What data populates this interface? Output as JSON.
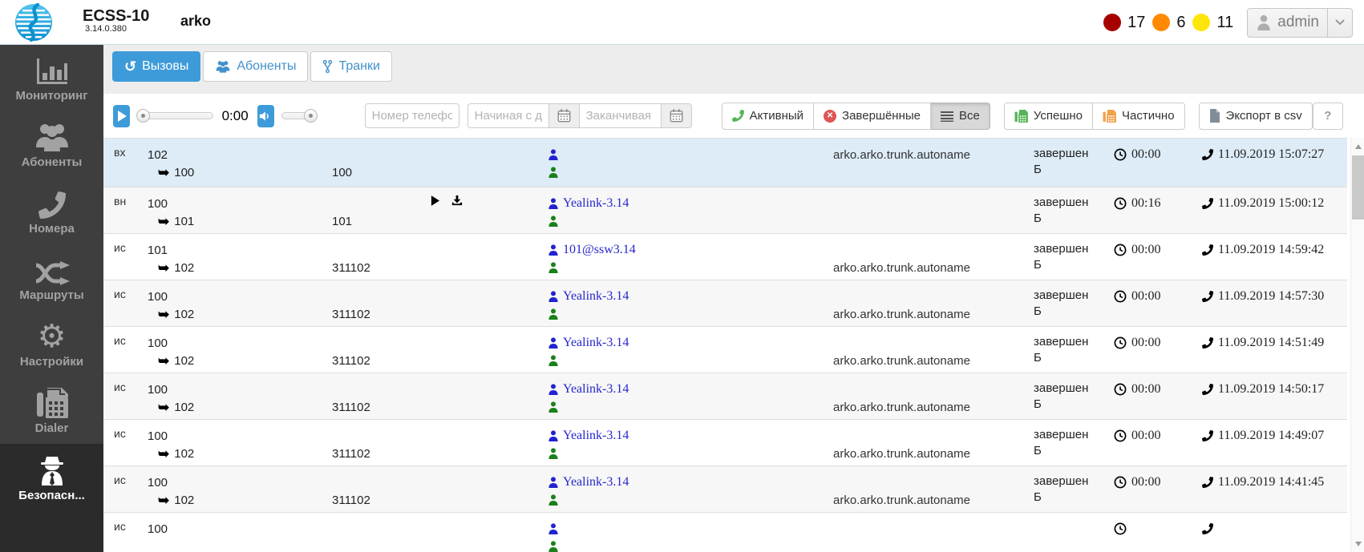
{
  "header": {
    "product": "ECSS-10",
    "version": "3.14.0.380",
    "domain": "arko",
    "alarms": [
      {
        "name": "critical",
        "color": "#a60000",
        "count": "17"
      },
      {
        "name": "major",
        "color": "#ff8a00",
        "count": "6"
      },
      {
        "name": "minor",
        "color": "#ffe60a",
        "count": "11"
      }
    ],
    "user": {
      "name": "admin"
    }
  },
  "sidebar": {
    "items": [
      {
        "label": "Мониторинг",
        "icon": "bar-chart-icon",
        "active": false
      },
      {
        "label": "Абоненты",
        "icon": "users-icon",
        "active": false
      },
      {
        "label": "Номера",
        "icon": "phone-icon",
        "active": false
      },
      {
        "label": "Маршруты",
        "icon": "shuffle-icon",
        "active": false
      },
      {
        "label": "Настройки",
        "icon": "gear-icon",
        "active": false
      },
      {
        "label": "Dialer",
        "icon": "fax-icon",
        "active": false
      },
      {
        "label": "Безопасн...",
        "icon": "spy-icon",
        "active": true
      }
    ]
  },
  "tabs": [
    {
      "label": "Вызовы",
      "icon": "history-icon",
      "active": true
    },
    {
      "label": "Абоненты",
      "icon": "users-icon",
      "active": false
    },
    {
      "label": "Транки",
      "icon": "branch-icon",
      "active": false
    }
  ],
  "player": {
    "time": "0:00",
    "progress_percent": 0,
    "volume_percent": 100
  },
  "filters": {
    "phone_placeholder": "Номер телефона",
    "date_from_placeholder": "Начиная с даты",
    "date_to_placeholder": "Заканчивая датой",
    "btn_active": "Активный",
    "btn_finished": "Завершённые",
    "btn_all": "Все",
    "btn_success": "Успешно",
    "btn_partial": "Частично",
    "btn_export": "Экспорт в csv",
    "btn_help": "?"
  },
  "icons": {
    "history-glyph": "↺",
    "arrow-forward-glyph": "➥",
    "x-glyph": "✕",
    "gear-glyph": "⚙"
  },
  "colors": {
    "accent_blue": "#3e9bd9",
    "tab_link_blue": "#4191ca",
    "selected_row": "#ddecf7",
    "caller_person": "#2222d2",
    "callee_person": "#1b801b",
    "success_green": "#56b456",
    "partial_orange": "#f0a24c",
    "finished_red": "#dd5655"
  },
  "table": {
    "rows": [
      {
        "type": "вх",
        "caller": "102",
        "callee": "100",
        "redirect": "100",
        "caller_label": "",
        "callee_label": "",
        "has_playback": false,
        "trunk": "arko.arko.trunk.autoname",
        "trunk_line": 1,
        "status_line1": "завершен",
        "status_line2": "Б",
        "duration": "00:00",
        "datetime": "11.09.2019 15:07:27",
        "selected": true
      },
      {
        "type": "вн",
        "caller": "100",
        "callee": "101",
        "redirect": "101",
        "caller_label": "Yealink-3.14",
        "callee_label": "",
        "has_playback": true,
        "trunk": "",
        "trunk_line": 2,
        "status_line1": "завершен",
        "status_line2": "Б",
        "duration": "00:16",
        "datetime": "11.09.2019 15:00:12",
        "selected": false
      },
      {
        "type": "ис",
        "caller": "101",
        "callee": "102",
        "redirect": "311102",
        "caller_label": "101@ssw3.14",
        "callee_label": "",
        "has_playback": false,
        "trunk": "arko.arko.trunk.autoname",
        "trunk_line": 2,
        "status_line1": "завершен",
        "status_line2": "Б",
        "duration": "00:00",
        "datetime": "11.09.2019 14:59:42",
        "selected": false
      },
      {
        "type": "ис",
        "caller": "100",
        "callee": "102",
        "redirect": "311102",
        "caller_label": "Yealink-3.14",
        "callee_label": "",
        "has_playback": false,
        "trunk": "arko.arko.trunk.autoname",
        "trunk_line": 2,
        "status_line1": "завершен",
        "status_line2": "Б",
        "duration": "00:00",
        "datetime": "11.09.2019 14:57:30",
        "selected": false
      },
      {
        "type": "ис",
        "caller": "100",
        "callee": "102",
        "redirect": "311102",
        "caller_label": "Yealink-3.14",
        "callee_label": "",
        "has_playback": false,
        "trunk": "arko.arko.trunk.autoname",
        "trunk_line": 2,
        "status_line1": "завершен",
        "status_line2": "Б",
        "duration": "00:00",
        "datetime": "11.09.2019 14:51:49",
        "selected": false
      },
      {
        "type": "ис",
        "caller": "100",
        "callee": "102",
        "redirect": "311102",
        "caller_label": "Yealink-3.14",
        "callee_label": "",
        "has_playback": false,
        "trunk": "arko.arko.trunk.autoname",
        "trunk_line": 2,
        "status_line1": "завершен",
        "status_line2": "Б",
        "duration": "00:00",
        "datetime": "11.09.2019 14:50:17",
        "selected": false
      },
      {
        "type": "ис",
        "caller": "100",
        "callee": "102",
        "redirect": "311102",
        "caller_label": "Yealink-3.14",
        "callee_label": "",
        "has_playback": false,
        "trunk": "arko.arko.trunk.autoname",
        "trunk_line": 2,
        "status_line1": "завершен",
        "status_line2": "Б",
        "duration": "00:00",
        "datetime": "11.09.2019 14:49:07",
        "selected": false
      },
      {
        "type": "ис",
        "caller": "100",
        "callee": "102",
        "redirect": "311102",
        "caller_label": "Yealink-3.14",
        "callee_label": "",
        "has_playback": false,
        "trunk": "arko.arko.trunk.autoname",
        "trunk_line": 2,
        "status_line1": "завершен",
        "status_line2": "Б",
        "duration": "00:00",
        "datetime": "11.09.2019 14:41:45",
        "selected": false
      },
      {
        "type": "ис",
        "caller": "100",
        "callee": "",
        "redirect": "",
        "caller_label": "",
        "callee_label": "",
        "has_playback": false,
        "trunk": "",
        "trunk_line": 2,
        "status_line1": "",
        "status_line2": "",
        "duration": "",
        "datetime": "",
        "selected": false
      }
    ]
  }
}
